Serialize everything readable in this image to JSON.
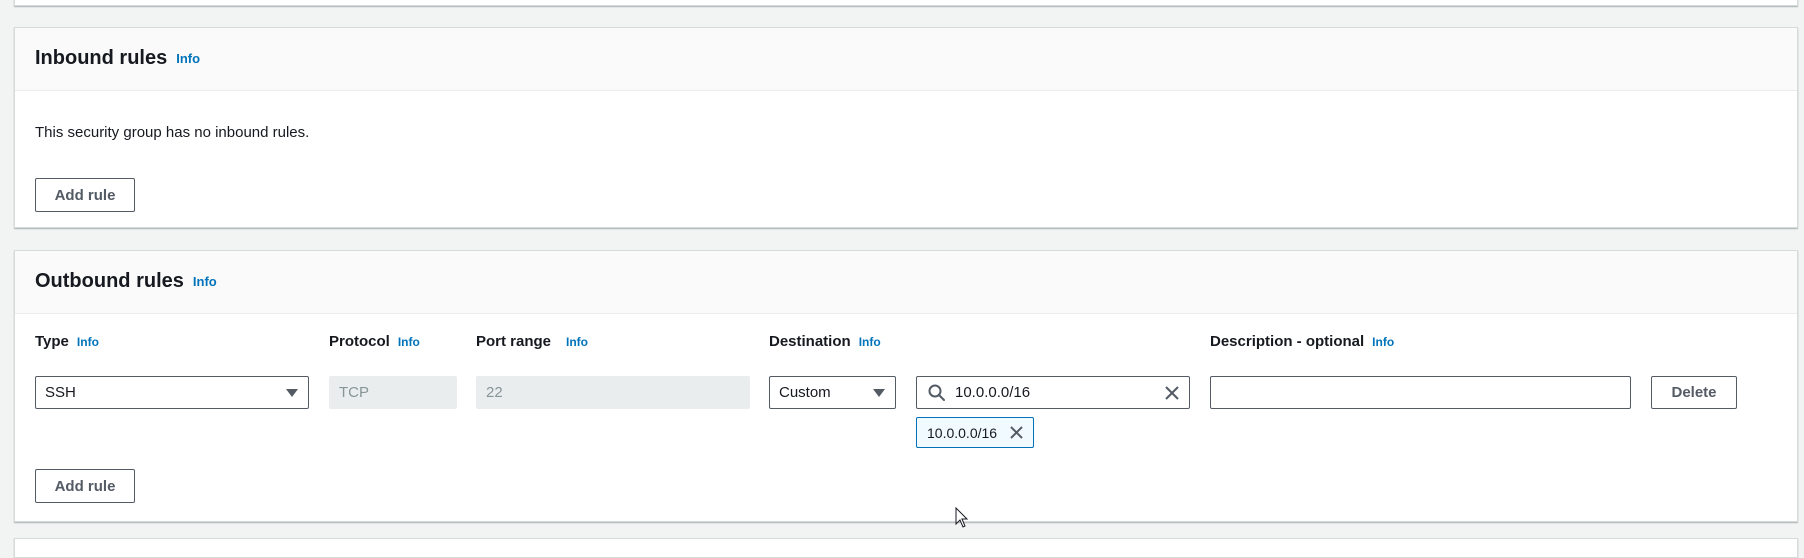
{
  "inbound": {
    "title": "Inbound rules",
    "info": "Info",
    "empty_message": "This security group has no inbound rules.",
    "add_rule_label": "Add rule"
  },
  "outbound": {
    "title": "Outbound rules",
    "info": "Info",
    "columns": {
      "type": "Type",
      "protocol": "Protocol",
      "port_range": "Port range",
      "destination": "Destination",
      "description": "Description - optional"
    },
    "column_info": "Info",
    "row": {
      "type_value": "SSH",
      "protocol_value": "TCP",
      "port_range_value": "22",
      "destination_mode": "Custom",
      "destination_search_value": "10.0.0.0/16",
      "destination_token": "10.0.0.0/16",
      "description_value": "",
      "delete_label": "Delete"
    },
    "add_rule_label": "Add rule"
  },
  "colors": {
    "info_link": "#0073bb",
    "button_border": "#545b64",
    "token_bg": "#f1faff",
    "token_border": "#0073bb"
  }
}
